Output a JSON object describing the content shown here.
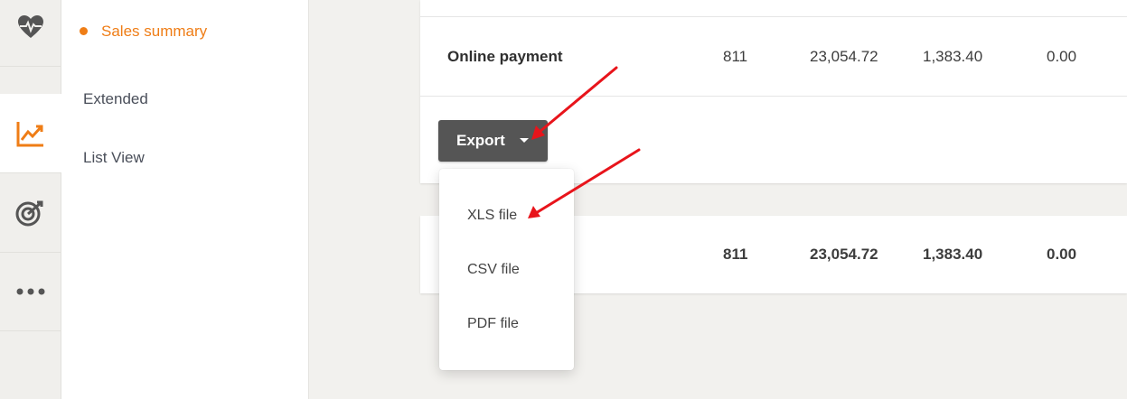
{
  "rail": {
    "items": [
      {
        "icon": "heart-pulse-icon",
        "active": false
      },
      {
        "icon": "trend-chart-icon",
        "active": true
      },
      {
        "icon": "target-icon",
        "active": false
      },
      {
        "icon": "more-dots-icon",
        "active": false
      }
    ],
    "accent_color": "#ef7d16"
  },
  "submenu": {
    "items": [
      {
        "label": "Sales summary",
        "active": true
      },
      {
        "label": "Extended",
        "active": false
      },
      {
        "label": "List View",
        "active": false
      }
    ]
  },
  "table": {
    "row": {
      "label": "Online payment",
      "values": [
        "811",
        "23,054.72",
        "1,383.40",
        "0.00"
      ]
    },
    "totals": {
      "values": [
        "811",
        "23,054.72",
        "1,383.40",
        "0.00"
      ]
    }
  },
  "export": {
    "label": "Export",
    "options": [
      "XLS file",
      "CSV file",
      "PDF file"
    ]
  },
  "annotation_color": "#e8141b"
}
